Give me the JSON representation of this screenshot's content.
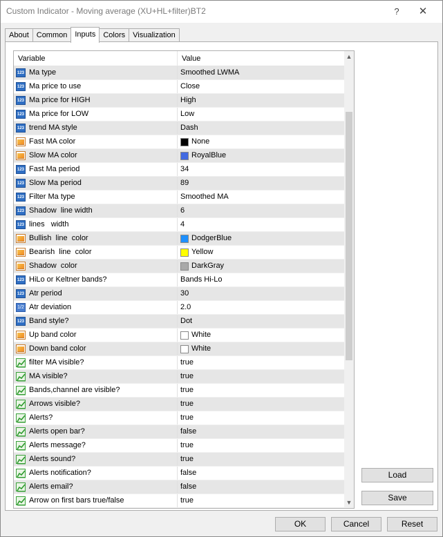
{
  "window": {
    "title": "Custom Indicator - Moving average (XU+HL+filter)BT2",
    "help_label": "?",
    "close_label": "✕"
  },
  "tabs": [
    {
      "label": "About",
      "active": false
    },
    {
      "label": "Common",
      "active": false
    },
    {
      "label": "Inputs",
      "active": true
    },
    {
      "label": "Colors",
      "active": false
    },
    {
      "label": "Visualization",
      "active": false
    }
  ],
  "grid": {
    "header": {
      "variable": "Variable",
      "value": "Value"
    },
    "rows": [
      {
        "type": "num",
        "icon": "integer-icon",
        "name": "Ma type",
        "value": "Smoothed LWMA"
      },
      {
        "type": "num",
        "icon": "integer-icon",
        "name": "Ma price to use",
        "value": "Close"
      },
      {
        "type": "num",
        "icon": "integer-icon",
        "name": "Ma price for HIGH",
        "value": "High"
      },
      {
        "type": "num",
        "icon": "integer-icon",
        "name": "Ma price for LOW",
        "value": "Low"
      },
      {
        "type": "num",
        "icon": "integer-icon",
        "name": "trend MA style",
        "value": "Dash"
      },
      {
        "type": "color",
        "icon": "color-icon",
        "name": "Fast MA color",
        "value": "None",
        "swatch": "#000000"
      },
      {
        "type": "color",
        "icon": "color-icon",
        "name": "Slow MA color",
        "value": "RoyalBlue",
        "swatch": "#4169e1"
      },
      {
        "type": "num",
        "icon": "integer-icon",
        "name": "Fast Ma period",
        "value": "34"
      },
      {
        "type": "num",
        "icon": "integer-icon",
        "name": "Slow Ma period",
        "value": "89"
      },
      {
        "type": "num",
        "icon": "integer-icon",
        "name": "Filter Ma type",
        "value": "Smoothed MA"
      },
      {
        "type": "num",
        "icon": "integer-icon",
        "name": "Shadow  line width",
        "value": "6"
      },
      {
        "type": "num",
        "icon": "integer-icon",
        "name": "lines   width",
        "value": "4"
      },
      {
        "type": "color",
        "icon": "color-icon",
        "name": "Bullish  line  color",
        "value": "DodgerBlue",
        "swatch": "#1e90ff"
      },
      {
        "type": "color",
        "icon": "color-icon",
        "name": "Bearish  line  color",
        "value": "Yellow",
        "swatch": "#ffff00"
      },
      {
        "type": "color",
        "icon": "color-icon",
        "name": "Shadow  color",
        "value": "DarkGray",
        "swatch": "#a9a9a9"
      },
      {
        "type": "num",
        "icon": "integer-icon",
        "name": "HiLo or Keltner bands?",
        "value": "Bands Hi-Lo"
      },
      {
        "type": "num",
        "icon": "integer-icon",
        "name": "Atr period",
        "value": "30"
      },
      {
        "type": "dbl",
        "icon": "double-icon",
        "name": "Atr deviation",
        "value": "2.0"
      },
      {
        "type": "num",
        "icon": "integer-icon",
        "name": "Band style?",
        "value": "Dot"
      },
      {
        "type": "color",
        "icon": "color-icon",
        "name": "Up band color",
        "value": "White",
        "swatch": "#ffffff"
      },
      {
        "type": "color",
        "icon": "color-icon",
        "name": "Down band color",
        "value": "White",
        "swatch": "#ffffff"
      },
      {
        "type": "bool",
        "icon": "boolean-icon",
        "name": "filter MA visible?",
        "value": "true"
      },
      {
        "type": "bool",
        "icon": "boolean-icon",
        "name": "MA visible?",
        "value": "true"
      },
      {
        "type": "bool",
        "icon": "boolean-icon",
        "name": "Bands,channel are visible?",
        "value": "true"
      },
      {
        "type": "bool",
        "icon": "boolean-icon",
        "name": "Arrows visible?",
        "value": "true"
      },
      {
        "type": "bool",
        "icon": "boolean-icon",
        "name": "Alerts?",
        "value": "true"
      },
      {
        "type": "bool",
        "icon": "boolean-icon",
        "name": "Alerts open bar?",
        "value": "false"
      },
      {
        "type": "bool",
        "icon": "boolean-icon",
        "name": "Alerts message?",
        "value": "true"
      },
      {
        "type": "bool",
        "icon": "boolean-icon",
        "name": "Alerts sound?",
        "value": "true"
      },
      {
        "type": "bool",
        "icon": "boolean-icon",
        "name": "Alerts notification?",
        "value": "false"
      },
      {
        "type": "bool",
        "icon": "boolean-icon",
        "name": "Alerts email?",
        "value": "false"
      },
      {
        "type": "bool",
        "icon": "boolean-icon",
        "name": "Arrow on first bars true/false",
        "value": "true"
      }
    ]
  },
  "buttons": {
    "load": "Load",
    "save": "Save",
    "ok": "OK",
    "cancel": "Cancel",
    "reset": "Reset"
  },
  "icon_labels": {
    "integer": "123",
    "double": "1/2"
  }
}
